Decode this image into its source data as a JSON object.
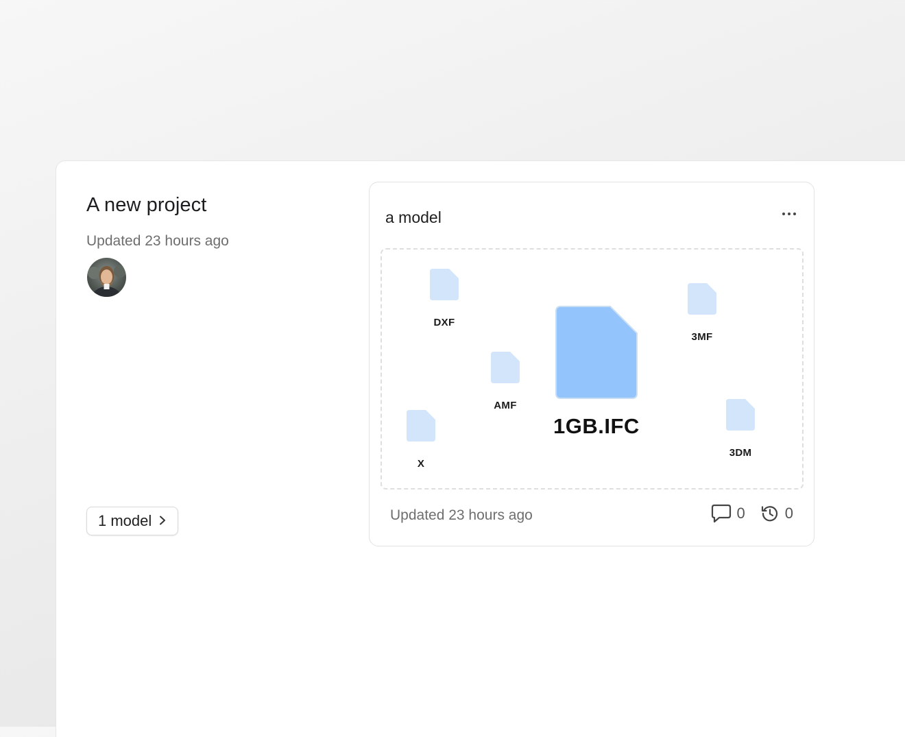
{
  "project": {
    "title": "A new project",
    "updated": "Updated 23 hours ago",
    "avatar_icon": "user-avatar-photo",
    "models_button_label": "1 model"
  },
  "model_card": {
    "name": "a model",
    "more_icon": "more-horizontal-icon",
    "updated": "Updated 23 hours ago",
    "comments_count": "0",
    "versions_count": "0",
    "preview": {
      "main_file": "1GB.IFC",
      "files": [
        "DXF",
        "3MF",
        "AMF",
        "X",
        "3DM"
      ]
    }
  },
  "colors": {
    "file_light": "#d3e5fb",
    "file_main": "#93c4fb",
    "file_main_border": "#c9ddf3"
  }
}
